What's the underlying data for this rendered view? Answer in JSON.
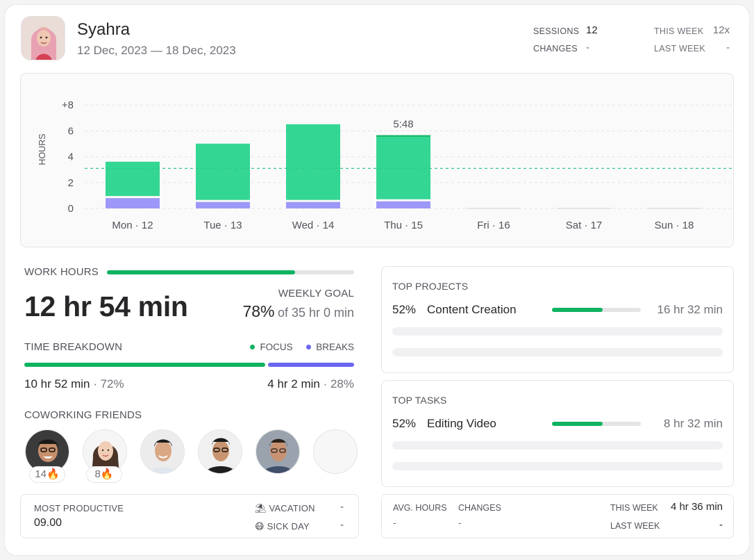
{
  "profile": {
    "name": "Syahra",
    "date_range": "12 Dec, 2023 — 18 Dec, 2023"
  },
  "header_stats": {
    "sessions_label": "SESSIONS",
    "sessions_value": "12",
    "changes_label": "CHANGES",
    "changes_value": "-",
    "this_week_label": "THIS WEEK",
    "this_week_value": "12x",
    "last_week_label": "LAST WEEK",
    "last_week_value": "-"
  },
  "chart_data": {
    "type": "bar",
    "ylabel": "HOURS",
    "ytick_labels": [
      "0",
      "2",
      "4",
      "6",
      "+8"
    ],
    "ylim": [
      0,
      8
    ],
    "categories": [
      "Mon · 12",
      "Tue · 13",
      "Wed · 14",
      "Thu · 15",
      "Fri · 16",
      "Sat · 17",
      "Sun · 18"
    ],
    "series": [
      {
        "name": "Focus",
        "values": [
          2.6,
          4.3,
          5.8,
          4.9,
          0,
          0,
          0
        ],
        "color": "#34d693"
      },
      {
        "name": "Breaks",
        "values": [
          0.8,
          0.5,
          0.5,
          0.55,
          0,
          0,
          0
        ],
        "color": "#9d98f7"
      }
    ],
    "average_line": 3.1,
    "average_line_color": "#34c78a",
    "bar_annotation": {
      "category_index": 3,
      "text": "5:48"
    },
    "grid": true
  },
  "work_hours": {
    "label": "WORK HOURS",
    "progress": 0.76,
    "total": "12 hr 54 min",
    "goal_label": "WEEKLY GOAL",
    "goal_percent": "78%",
    "goal_of": "of 35 hr 0 min"
  },
  "breakdown": {
    "label": "TIME BREAKDOWN",
    "legend_focus": "FOCUS",
    "legend_breaks": "BREAKS",
    "focus_color": "#10b360",
    "breaks_color": "#6b66f0",
    "focus_fraction": 0.72,
    "focus_time": "10 hr 52 min",
    "focus_pct": " · 72%",
    "breaks_time": "4 hr 2 min",
    "breaks_pct": " · 28%"
  },
  "friends": {
    "label": "COWORKING FRIENDS",
    "list": [
      {
        "badge": "14🔥"
      },
      {
        "badge": "8🔥"
      },
      {
        "badge": ""
      },
      {
        "badge": ""
      },
      {
        "badge": ""
      }
    ]
  },
  "productivity": {
    "most_productive_label": "MOST PRODUCTIVE",
    "most_productive_value": "09.00",
    "vacation_icon": "⛱",
    "vacation_label": "VACATION",
    "vacation_value": "-",
    "sick_icon": "😷",
    "sick_label": "SICK DAY",
    "sick_value": "-"
  },
  "top_projects": {
    "label": "TOP PROJECTS",
    "pct": "52%",
    "name": "Content Creation",
    "progress": 0.57,
    "time": "16 hr 32 min"
  },
  "top_tasks": {
    "label": "TOP TASKS",
    "pct": "52%",
    "name": "Editing Video",
    "progress": 0.57,
    "time": "8 hr 32 min"
  },
  "averages": {
    "avg_hours_label": "AVG. HOURS",
    "avg_hours_value": "-",
    "changes_label": "CHANGES",
    "changes_value": "-",
    "this_week_label": "THIS WEEK",
    "this_week_value": "4 hr 36 min",
    "last_week_label": "LAST WEEK",
    "last_week_value": "-"
  }
}
